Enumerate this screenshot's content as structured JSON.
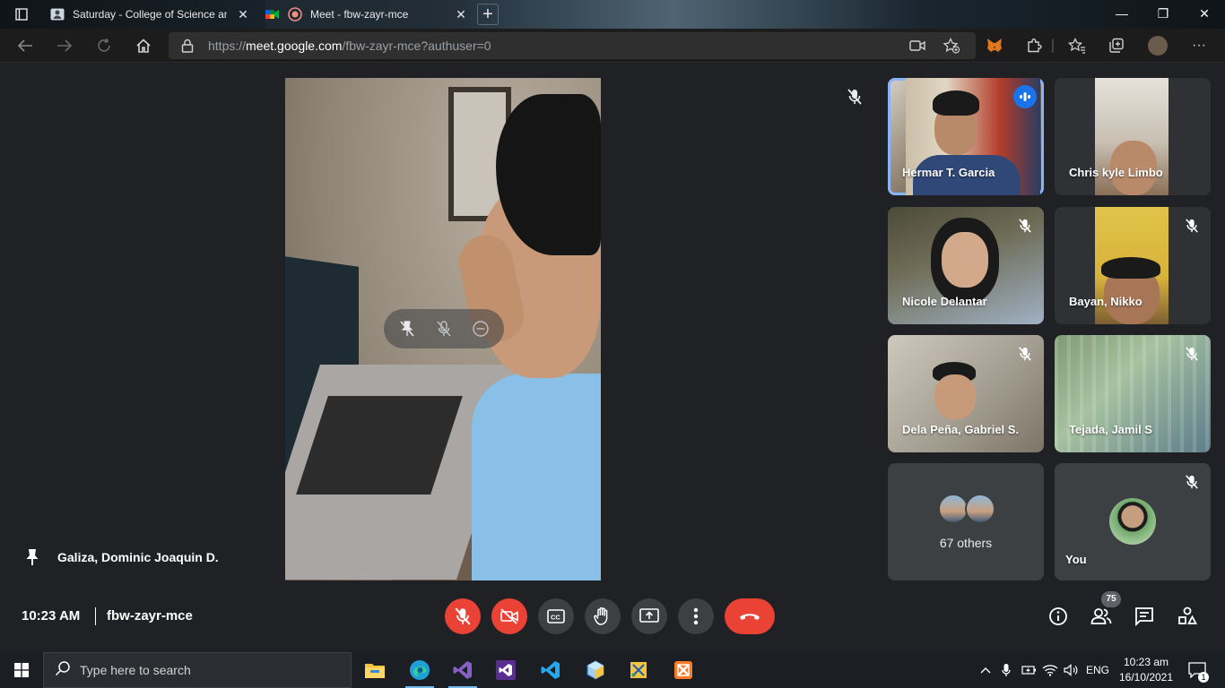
{
  "browser": {
    "tabs": [
      {
        "title": "Saturday - College of Science and",
        "favicon": "person-card-icon"
      },
      {
        "title": "Meet - fbw-zayr-mce",
        "favicon": "google-meet-icon",
        "active": true
      }
    ],
    "url_prefix": "https://",
    "url_host": "meet.google.com",
    "url_path": "/fbw-zayr-mce?authuser=0"
  },
  "meet": {
    "pinned_participant": "Galiza, Dominic Joaquin D.",
    "participants": [
      {
        "name": "Hermar T. Garcia",
        "speaking": true,
        "muted": false
      },
      {
        "name": "Chris kyle Limbo",
        "muted": false
      },
      {
        "name": "Nicole Delantar",
        "muted": true
      },
      {
        "name": "Bayan, Nikko",
        "muted": true
      },
      {
        "name": "Dela Peña, Gabriel S.",
        "muted": true
      },
      {
        "name": "Tejada, Jamil S",
        "muted": true
      }
    ],
    "others_label": "67 others",
    "self_label": "You",
    "time": "10:23 AM",
    "meeting_code": "fbw-zayr-mce",
    "people_count": "75",
    "colors": {
      "end_call": "#ea4335",
      "control_bg": "#3c4043",
      "speaking": "#1a73e8",
      "accent": "#8ab4f8"
    }
  },
  "taskbar": {
    "search_placeholder": "Type here to search",
    "language": "ENG",
    "clock_time": "10:23 am",
    "clock_date": "16/10/2021",
    "notification_count": "1"
  }
}
